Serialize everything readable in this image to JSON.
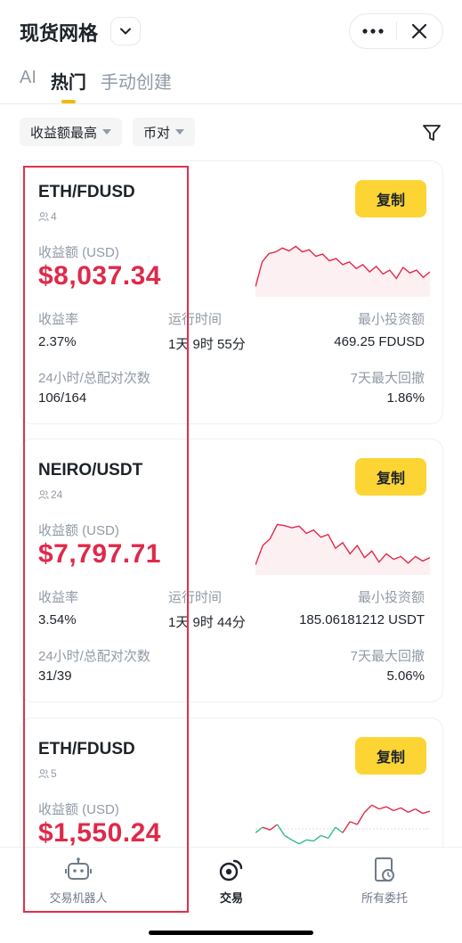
{
  "header": {
    "title": "现货网格",
    "icons": {
      "dropdown": "chevron-down-icon",
      "more": "more-dots-icon",
      "close": "close-icon"
    }
  },
  "tabs": [
    {
      "label": "AI",
      "active": false
    },
    {
      "label": "热门",
      "active": true
    },
    {
      "label": "手动创建",
      "active": false
    }
  ],
  "filters": {
    "sort": "收益额最高",
    "pair": "币对",
    "filter_icon": "funnel-icon"
  },
  "cards": [
    {
      "pair": "ETH/FDUSD",
      "users": "4",
      "copy_label": "复制",
      "pnl_label": "收益额 (USD)",
      "pnl": "$8,037.34",
      "roi_label": "收益率",
      "roi": "2.37%",
      "runtime_label": "运行时间",
      "runtime": "1天 9时 55分",
      "min_invest_label": "最小投资额",
      "min_invest": "469.25 FDUSD",
      "matched_label": "24小时/总配对次数",
      "matched": "106/164",
      "drawdown_label": "7天最大回撤",
      "drawdown": "1.86%",
      "sparkline": [
        0.15,
        0.6,
        0.75,
        0.78,
        0.85,
        0.8,
        0.88,
        0.78,
        0.82,
        0.7,
        0.74,
        0.62,
        0.66,
        0.55,
        0.6,
        0.48,
        0.55,
        0.42,
        0.52,
        0.38,
        0.45,
        0.3,
        0.5,
        0.4,
        0.45,
        0.32,
        0.42
      ]
    },
    {
      "pair": "NEIRO/USDT",
      "users": "24",
      "copy_label": "复制",
      "pnl_label": "收益额 (USD)",
      "pnl": "$7,797.71",
      "roi_label": "收益率",
      "roi": "3.54%",
      "runtime_label": "运行时间",
      "runtime": "1天 9时 44分",
      "min_invest_label": "最小投资额",
      "min_invest": "185.06181212 USDT",
      "matched_label": "24小时/总配对次数",
      "matched": "31/39",
      "drawdown_label": "7天最大回撤",
      "drawdown": "5.06%",
      "sparkline": [
        0.15,
        0.5,
        0.62,
        0.88,
        0.86,
        0.82,
        0.85,
        0.72,
        0.78,
        0.65,
        0.7,
        0.45,
        0.55,
        0.35,
        0.5,
        0.28,
        0.4,
        0.2,
        0.35,
        0.25,
        0.3,
        0.18,
        0.3,
        0.22,
        0.28
      ]
    },
    {
      "pair": "ETH/FDUSD",
      "users": "5",
      "copy_label": "复制",
      "pnl_label": "收益额 (USD)",
      "pnl": "$1,550.24",
      "sparkline": [
        0.35,
        0.45,
        0.4,
        0.5,
        0.3,
        0.22,
        0.15,
        0.22,
        0.2,
        0.3,
        0.25,
        0.45,
        0.35,
        0.55,
        0.5,
        0.72,
        0.85,
        0.78,
        0.82,
        0.75,
        0.8,
        0.72,
        0.78,
        0.7,
        0.74
      ],
      "baseline": 0.42
    }
  ],
  "colors": {
    "accent": "#fcd535",
    "loss": "#e0294a",
    "gain": "#2ebd85",
    "muted": "#929aa5",
    "text": "#1e2329",
    "highlight_box": "#e0304a"
  },
  "bottom_nav": [
    {
      "label": "交易机器人",
      "icon": "robot-icon",
      "active": false
    },
    {
      "label": "交易",
      "icon": "trade-icon",
      "active": true
    },
    {
      "label": "所有委托",
      "icon": "orders-icon",
      "active": false
    }
  ]
}
